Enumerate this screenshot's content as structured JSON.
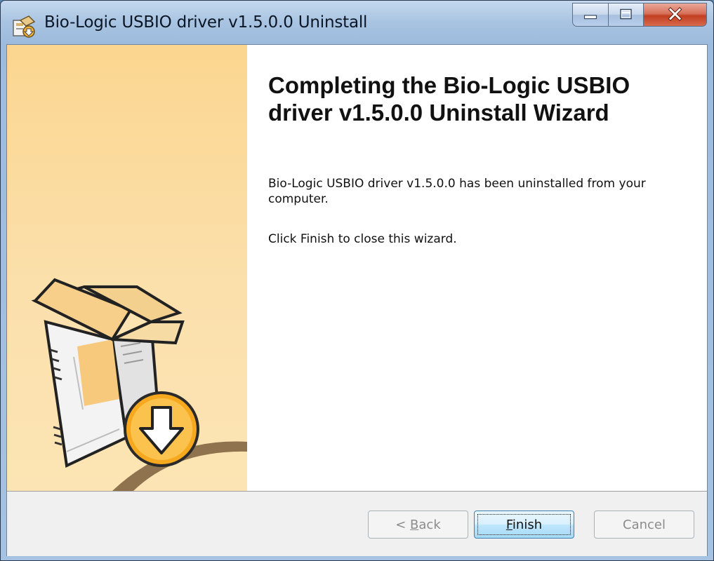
{
  "window": {
    "title": "Bio-Logic USBIO driver v1.5.0.0 Uninstall"
  },
  "icons": {
    "app": "installer-app-icon",
    "minimize": "minimize-icon",
    "maximize": "maximize-icon",
    "close": "close-icon",
    "box": "software-box-icon",
    "arrow": "download-arrow-icon"
  },
  "content": {
    "heading": "Completing the Bio-Logic USBIO driver v1.5.0.0 Uninstall Wizard",
    "message": "Bio-Logic USBIO driver v1.5.0.0 has been uninstalled from your computer.",
    "instruction": "Click Finish to close this wizard."
  },
  "buttons": {
    "back_prefix": "< ",
    "back_mnemonic": "B",
    "back_rest": "ack",
    "finish_mnemonic": "F",
    "finish_rest": "inish",
    "cancel": "Cancel"
  },
  "colors": {
    "side_panel": "#fbd690",
    "close_button": "#c23f22",
    "default_button_border": "#3c7fb1"
  }
}
